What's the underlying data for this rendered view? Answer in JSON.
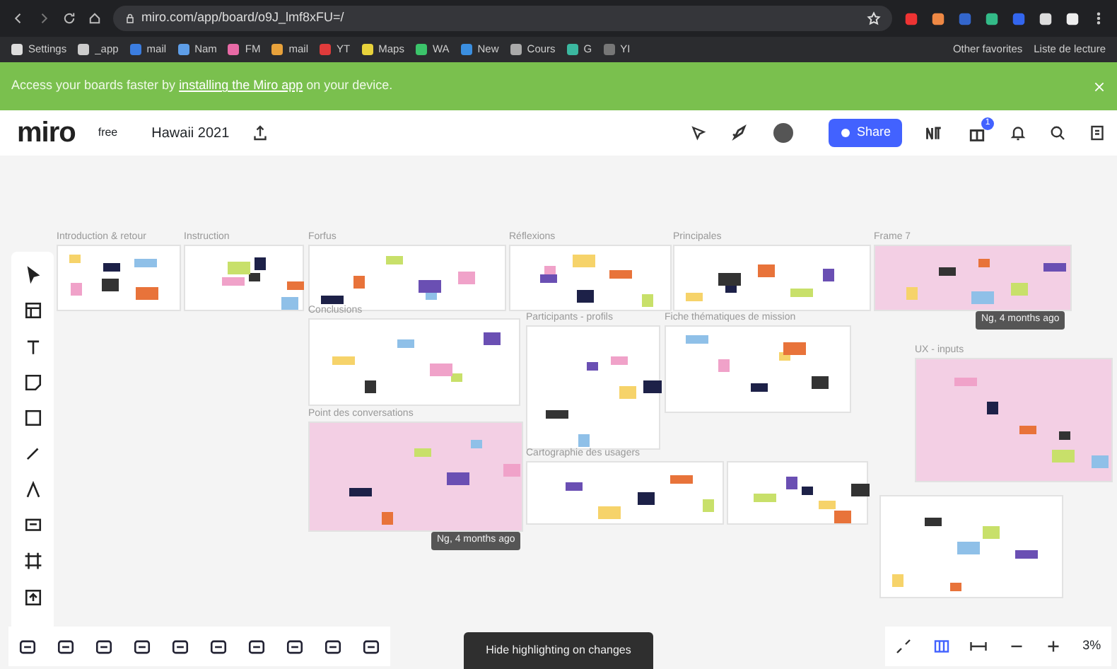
{
  "browser": {
    "url": "miro.com/app/board/o9J_lmf8xFU=/",
    "bookmarks": [
      {
        "label": "Settings",
        "color": "#dddddd"
      },
      {
        "label": "_app",
        "color": "#cccccc"
      },
      {
        "label": "mail",
        "color": "#3b7de0"
      },
      {
        "label": "Nam",
        "color": "#5e9ee8"
      },
      {
        "label": "FM",
        "color": "#e86aa6"
      },
      {
        "label": "mail",
        "color": "#e8a23b"
      },
      {
        "label": "YT",
        "color": "#e03b3b"
      },
      {
        "label": "Maps",
        "color": "#e8d23b"
      },
      {
        "label": "WA",
        "color": "#3bc46a"
      },
      {
        "label": "New",
        "color": "#3b8fe0"
      },
      {
        "label": "Cours",
        "color": "#aaaaaa"
      },
      {
        "label": "G",
        "color": "#3bb8a0"
      },
      {
        "label": "YI",
        "color": "#777777"
      }
    ],
    "other_bookmarks": "Other favorites",
    "reading_list": "Liste de lecture"
  },
  "banner": {
    "before": "Access your boards faster by ",
    "link": "installing the Miro app",
    "after": " on your device."
  },
  "header": {
    "logo": "miro",
    "plan": "free",
    "board_title": "Hawaii 2021",
    "share": "Share",
    "notification_count": "1"
  },
  "frames": [
    {
      "label": "Introduction & retour",
      "color": "#ffffff"
    },
    {
      "label": "Instruction",
      "color": "#ffffff"
    },
    {
      "label": "Forfus",
      "color": "#ffffff"
    },
    {
      "label": "Réflexions",
      "color": "#ffffff"
    },
    {
      "label": "Principales",
      "color": "#ffffff"
    },
    {
      "label": "Frame 7",
      "color": "#f3cfe4"
    },
    {
      "label": "Conclusions",
      "color": "#ffffff"
    },
    {
      "label": "Participants - profils",
      "color": "#ffffff"
    },
    {
      "label": "Fiche thématiques de mission",
      "color": "#ffffff"
    },
    {
      "label": "UX - inputs",
      "color": "#f3cfe4"
    },
    {
      "label": "Point des conversations",
      "color": "#f3cfe4"
    },
    {
      "label": "Cartographie des usagers",
      "color": "#ffffff"
    },
    {
      "color": "#ffffff"
    },
    {
      "color": "#ffffff"
    }
  ],
  "badges": [
    "Ng, 4 months ago",
    "Ng, 4 months ago"
  ],
  "tooltip": "Hide highlighting on changes",
  "zoom": "3%"
}
